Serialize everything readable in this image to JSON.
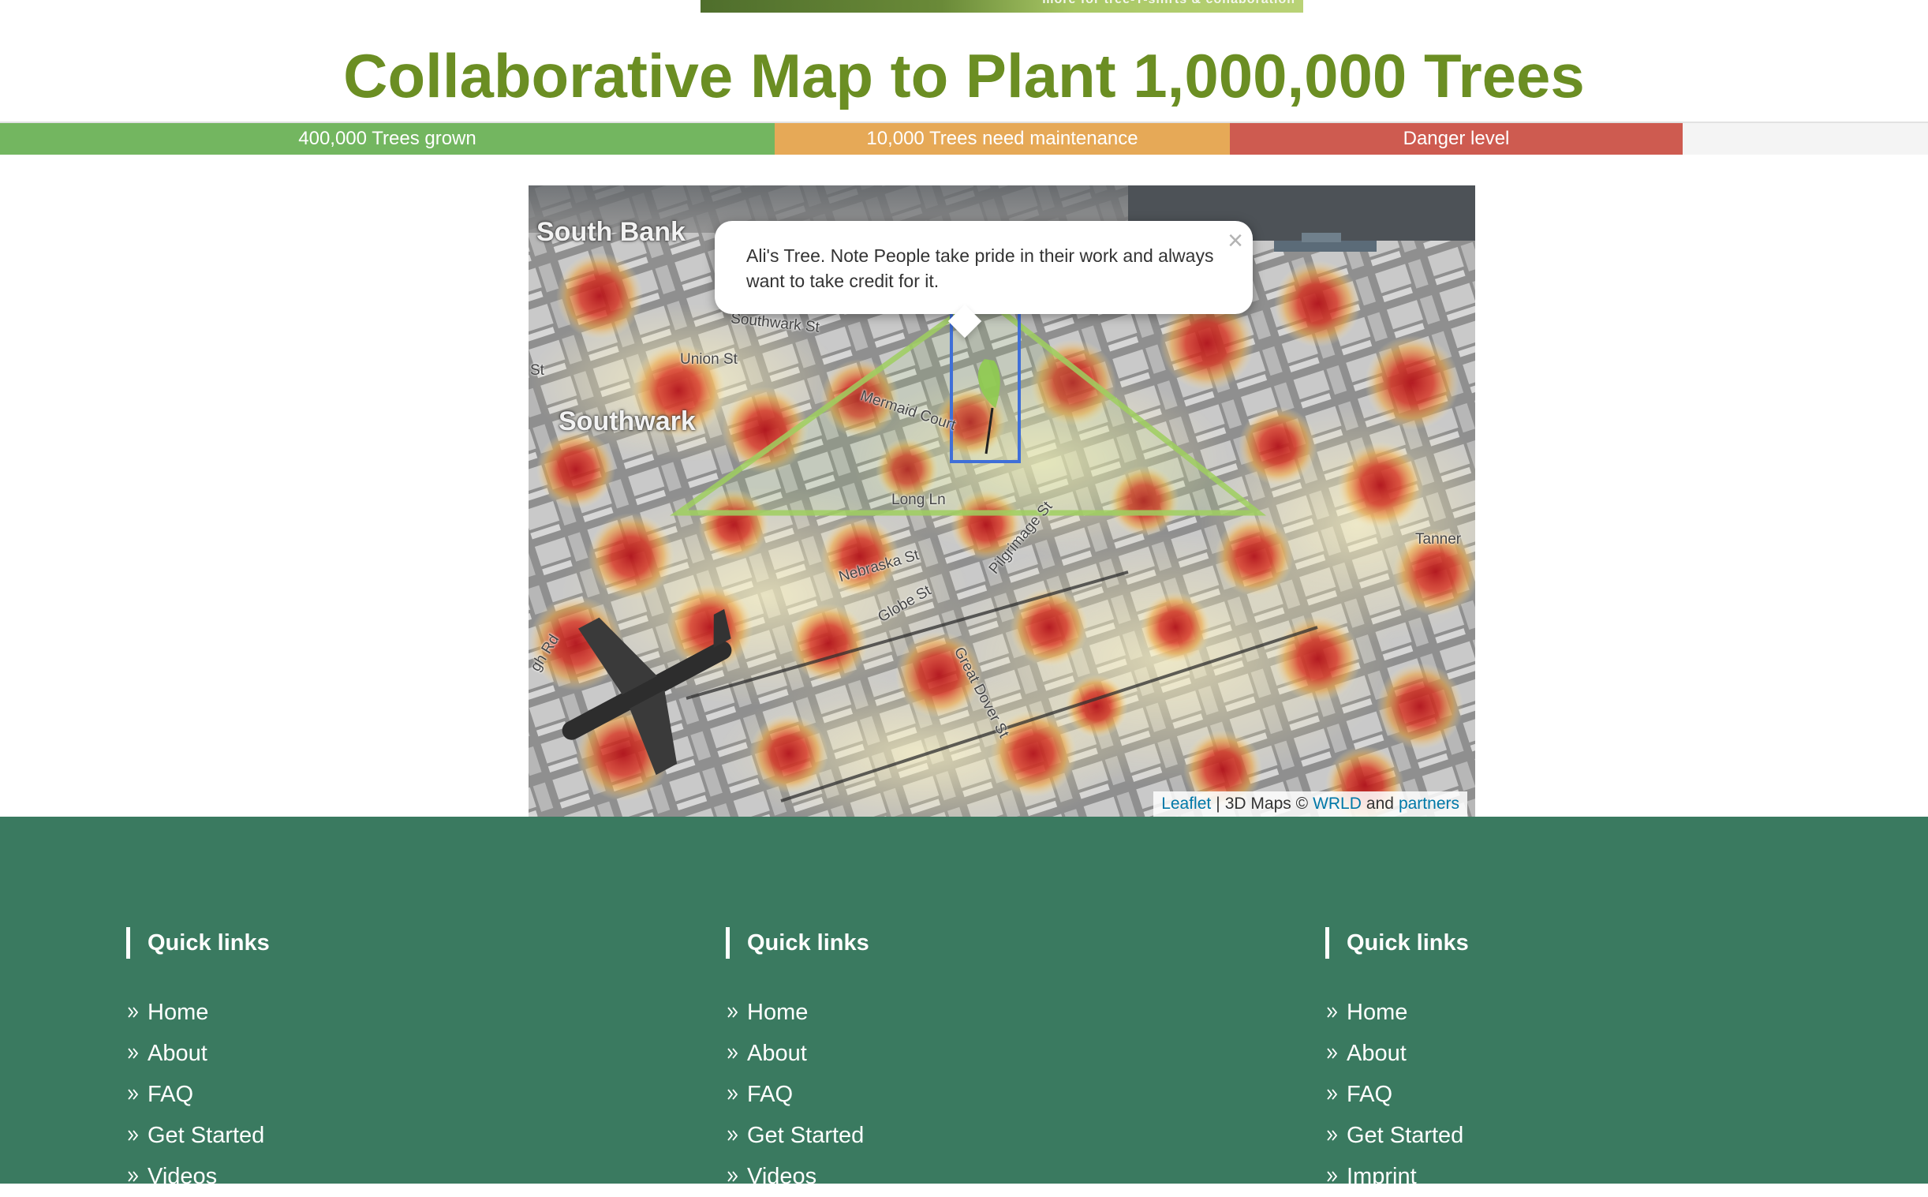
{
  "banner": {
    "text": "more for tree-T-shirts & collaboration"
  },
  "page_title": "Collaborative Map to Plant 1,000,000 Trees",
  "progress": {
    "grown": {
      "label": "400,000 Trees grown",
      "fraction": 0.402,
      "color": "#73b660"
    },
    "maintenance": {
      "label": "10,000 Trees need maintenance",
      "fraction": 0.236,
      "color": "#e6a957"
    },
    "danger": {
      "label": "Danger level",
      "fraction": 0.235,
      "color": "#ce5b50"
    }
  },
  "map": {
    "labels": {
      "south_bank": "South Bank",
      "southwark": "Southwark",
      "southwark_st": "Southwark St",
      "union_st": "Union St",
      "st_left": "St",
      "mermaid_court": "Mermaid Court",
      "long_ln": "Long Ln",
      "nebraska_st": "Nebraska St",
      "globe_st": "Globe St",
      "pilgrimage_st": "Pilgrimage St",
      "great_dover_st": "Great Dover St",
      "tanner": "Tanner",
      "high_rd": "gh Rd"
    },
    "popup": {
      "text": "Ali's Tree. Note People take pride in their work and always want to take credit for it.",
      "close": "×"
    },
    "attribution": {
      "leaflet": "Leaflet",
      "separator": "|",
      "maps": "3D Maps ©",
      "wrld": "WRLD",
      "and": "and",
      "partners": "partners"
    }
  },
  "footer": {
    "columns": [
      {
        "heading": "Quick links",
        "links": [
          "Home",
          "About",
          "FAQ",
          "Get Started",
          "Videos"
        ]
      },
      {
        "heading": "Quick links",
        "links": [
          "Home",
          "About",
          "FAQ",
          "Get Started",
          "Videos"
        ]
      },
      {
        "heading": "Quick links",
        "links": [
          "Home",
          "About",
          "FAQ",
          "Get Started",
          "Imprint"
        ]
      }
    ]
  }
}
